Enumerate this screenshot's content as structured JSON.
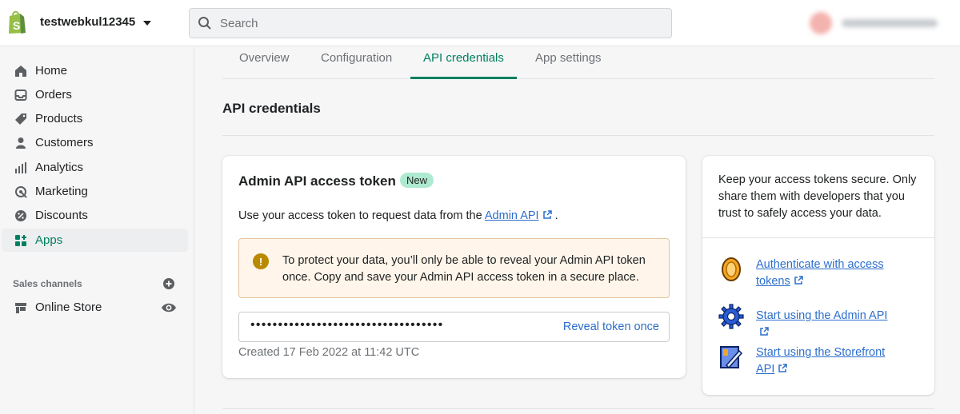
{
  "topbar": {
    "store_name": "testwebkul12345",
    "search_placeholder": "Search"
  },
  "sidebar": {
    "items": [
      {
        "label": "Home",
        "icon": "home-icon"
      },
      {
        "label": "Orders",
        "icon": "inbox-icon"
      },
      {
        "label": "Products",
        "icon": "tag-icon"
      },
      {
        "label": "Customers",
        "icon": "person-icon"
      },
      {
        "label": "Analytics",
        "icon": "bar-chart-icon"
      },
      {
        "label": "Marketing",
        "icon": "target-icon"
      },
      {
        "label": "Discounts",
        "icon": "discount-icon"
      },
      {
        "label": "Apps",
        "icon": "apps-icon",
        "active": true
      }
    ],
    "sales_channels_title": "Sales channels",
    "online_store_label": "Online Store"
  },
  "tabs": [
    {
      "label": "Overview"
    },
    {
      "label": "Configuration"
    },
    {
      "label": "API credentials",
      "active": true
    },
    {
      "label": "App settings"
    }
  ],
  "page": {
    "title": "API credentials"
  },
  "token_card": {
    "title": "Admin API access token",
    "badge": "New",
    "desc_prefix": "Use your access token to request data from the ",
    "desc_link": "Admin API",
    "desc_suffix": " .",
    "warning": "To protect your data, you’ll only be able to reveal your Admin API token once. Copy and save your Admin API access token in a secure place.",
    "token_masked": "•••••••••••••••••••••••••••••••••••",
    "reveal_label": "Reveal token once",
    "created": "Created 17 Feb 2022 at 11:42 UTC"
  },
  "side_card": {
    "text": "Keep your access tokens secure. Only share them with developers that you trust to safely access your data.",
    "links": [
      {
        "label": "Authenticate with access tokens",
        "icon": "coin-icon"
      },
      {
        "label": "Start using the Admin API",
        "icon": "gear-icon"
      },
      {
        "label": "Start using the Storefront API",
        "icon": "storefront-icon"
      }
    ]
  },
  "colors": {
    "accent": "#008060",
    "link": "#2c6ecb",
    "badge_bg": "#aee9d1",
    "warning_bg": "#fff5ea",
    "warning_icon": "#b98900"
  }
}
